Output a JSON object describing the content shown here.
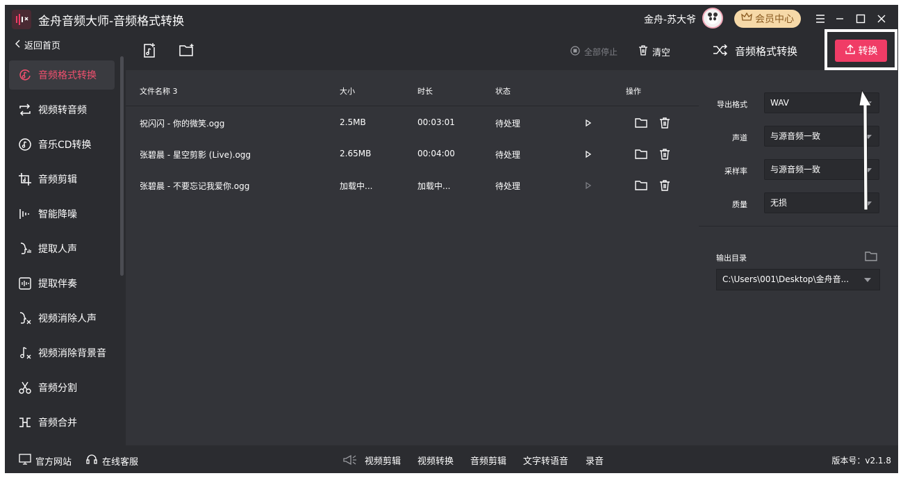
{
  "window": {
    "title": "金舟音频大师-音频格式转换",
    "username": "金舟-苏大爷",
    "vip_label": "会员中心"
  },
  "sidebar": {
    "back_label": "返回首页",
    "items": [
      {
        "label": "音频格式转换",
        "icon": "audio-convert-icon"
      },
      {
        "label": "视频转音频",
        "icon": "loop-icon"
      },
      {
        "label": "音乐CD转换",
        "icon": "music-disc-icon"
      },
      {
        "label": "音频剪辑",
        "icon": "audio-cut-icon"
      },
      {
        "label": "智能降噪",
        "icon": "waveform-icon"
      },
      {
        "label": "提取人声",
        "icon": "voice-icon"
      },
      {
        "label": "提取伴奏",
        "icon": "accompaniment-icon"
      },
      {
        "label": "视频消除人声",
        "icon": "remove-voice-icon"
      },
      {
        "label": "视频消除背景音",
        "icon": "remove-bgm-icon"
      },
      {
        "label": "音频分割",
        "icon": "scissors-icon"
      },
      {
        "label": "音频合并",
        "icon": "merge-icon"
      }
    ]
  },
  "toolbar": {
    "stop_all": "全部停止",
    "clear": "清空"
  },
  "table": {
    "headers": {
      "name": "文件名称 3",
      "size": "大小",
      "duration": "时长",
      "status": "状态",
      "actions": "操作"
    },
    "rows": [
      {
        "name": "祝闪闪 - 你的微笑.ogg",
        "size": "2.5MB",
        "duration": "00:03:01",
        "status": "待处理"
      },
      {
        "name": "张碧晨 - 星空剪影 (Live).ogg",
        "size": "2.65MB",
        "duration": "00:04:00",
        "status": "待处理"
      },
      {
        "name": "张碧晨 - 不要忘记我爱你.ogg",
        "size": "加载中...",
        "duration": "加载中...",
        "status": "待处理"
      }
    ]
  },
  "panel": {
    "title": "音频格式转换",
    "convert_label": "转换",
    "fields": [
      {
        "label": "导出格式",
        "value": "WAV"
      },
      {
        "label": "声道",
        "value": "与源音频一致"
      },
      {
        "label": "采样率",
        "value": "与源音频一致"
      },
      {
        "label": "质量",
        "value": "无损"
      }
    ],
    "output_label": "输出目录",
    "output_path": "C:\\Users\\001\\Desktop\\金舟音..."
  },
  "footer": {
    "website": "官方网站",
    "support": "在线客服",
    "links": [
      "视频剪辑",
      "视频转换",
      "音频剪辑",
      "文字转语音",
      "录音"
    ],
    "version": "版本号：v2.1.8"
  },
  "colors": {
    "accent": "#f03c66",
    "bg": "#2b2c30"
  }
}
